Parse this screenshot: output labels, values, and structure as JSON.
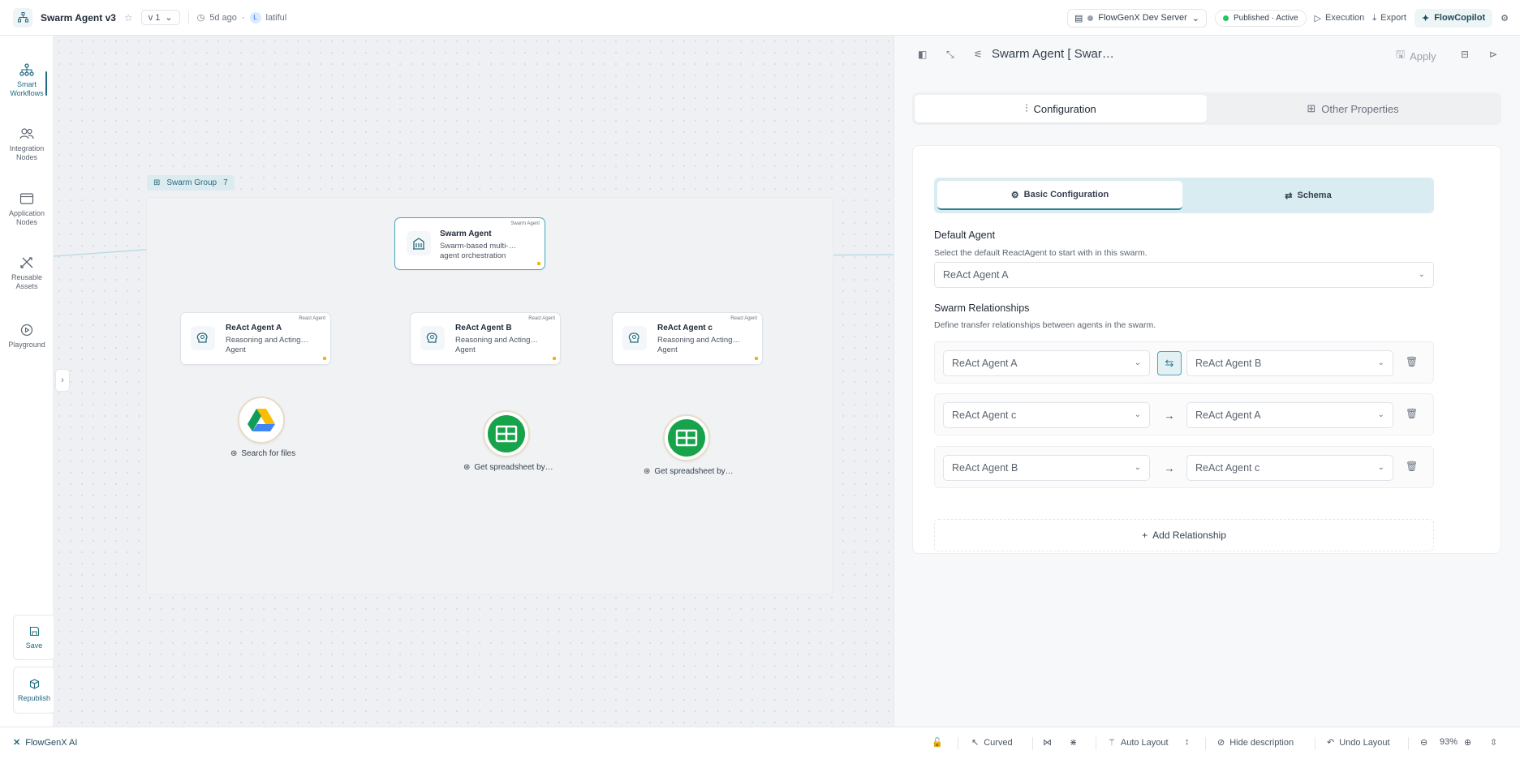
{
  "topbar": {
    "title": "Swarm Agent v3",
    "version": "v 1",
    "time_ago": "5d ago",
    "user_initial": "L",
    "user": "latiful",
    "server": "FlowGenX Dev Server",
    "status": "Published · Active",
    "execution": "Execution",
    "export": "Export",
    "copilot": "FlowCopilot"
  },
  "sidebar": {
    "items": [
      {
        "label": "Smart Workflows"
      },
      {
        "label": "Integration Nodes"
      },
      {
        "label": "Application Nodes"
      },
      {
        "label": "Reusable Assets"
      },
      {
        "label": "Playground"
      }
    ],
    "save": "Save",
    "republish": "Republish"
  },
  "canvas": {
    "group": {
      "label": "Swarm Group",
      "count": "7"
    },
    "swarm_node": {
      "type": "Swarm Agent",
      "title": "Swarm Agent",
      "desc": "Swarm-based multi-… agent orchestration"
    },
    "agents": [
      {
        "type": "React Agent",
        "title": "ReAct Agent A",
        "desc": "Reasoning and Acting… Agent"
      },
      {
        "type": "React Agent",
        "title": "ReAct Agent B",
        "desc": "Reasoning and Acting… Agent"
      },
      {
        "type": "React Agent",
        "title": "ReAct Agent c",
        "desc": "Reasoning and Acting… Agent"
      }
    ],
    "tools": [
      {
        "label": "Search for files",
        "icon": "google-drive-icon"
      },
      {
        "label": "Get spreadsheet by…",
        "icon": "google-sheets-icon"
      },
      {
        "label": "Get spreadsheet by…",
        "icon": "google-sheets-icon"
      }
    ]
  },
  "panel": {
    "title": "Swarm Agent [ Swar…",
    "apply": "Apply",
    "tabs": [
      "Configuration",
      "Other Properties"
    ],
    "subtabs": [
      "Basic Configuration",
      "Schema"
    ],
    "default_agent": {
      "title": "Default Agent",
      "desc": "Select the default ReactAgent to start with in this swarm.",
      "value": "ReAct Agent A"
    },
    "relationships": {
      "title": "Swarm Relationships",
      "desc": "Define transfer relationships between agents in the swarm.",
      "rows": [
        {
          "from": "ReAct Agent A",
          "to": "ReAct Agent B",
          "direction": "bidirectional"
        },
        {
          "from": "ReAct Agent c",
          "to": "ReAct Agent A",
          "direction": "one-way"
        },
        {
          "from": "ReAct Agent B",
          "to": "ReAct Agent c",
          "direction": "one-way"
        }
      ],
      "add": "Add Relationship"
    }
  },
  "bottombar": {
    "brand": "FlowGenX AI",
    "curved": "Curved",
    "auto_layout": "Auto Layout",
    "hide_description": "Hide description",
    "undo_layout": "Undo Layout",
    "zoom": "93%"
  },
  "colors": {
    "accent": "#1f6b80",
    "selected_border": "#4aa6bd",
    "active_status": "#22c55e"
  }
}
